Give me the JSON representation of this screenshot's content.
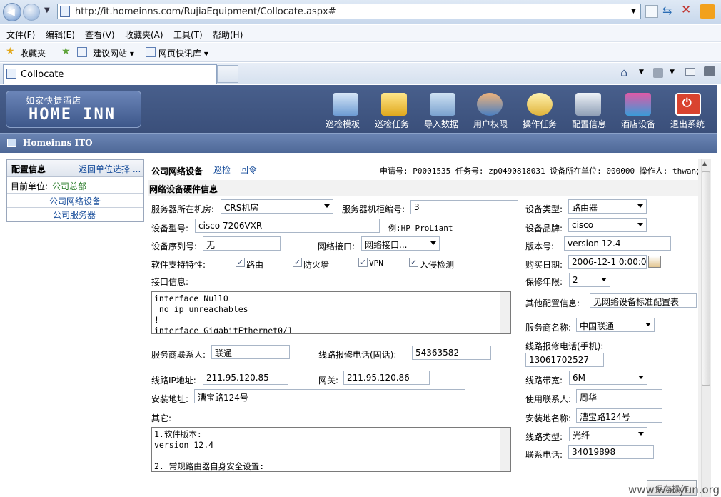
{
  "browser": {
    "url": "http://it.homeinns.com/RujiaEquipment/Collocate.aspx#",
    "menu": [
      "文件(F)",
      "编辑(E)",
      "查看(V)",
      "收藏夹(A)",
      "工具(T)",
      "帮助(H)"
    ],
    "favorites_label": "收藏夹",
    "fav_links": [
      "建议网站 ▾",
      "网页快讯库 ▾"
    ],
    "tab_title": "Collocate"
  },
  "header": {
    "logo_cn": "如家快捷酒店",
    "logo_en": "HOME INN",
    "nav": [
      "巡检模板",
      "巡检任务",
      "导入数据",
      "用户权限",
      "操作任务",
      "配置信息",
      "酒店设备",
      "退出系统"
    ],
    "subtitle": "Homeinns ITO"
  },
  "left": {
    "title": "配置信息",
    "back_link": "返回单位选择 ...",
    "current_unit_label": "目前单位:",
    "current_unit": "公司总部",
    "items": [
      "公司网络设备",
      "公司服务器"
    ]
  },
  "main": {
    "title": "公司网络设备",
    "link1": "巡检",
    "link2": "回令",
    "info": "申请号: P0001535  任务号: zp0490818031 设备所在单位: 000000 操作人: thwang",
    "section": "网络设备硬件信息",
    "fields": {
      "room_label": "服务器所在机房:",
      "room": "CRS机房",
      "cabinet_label": "服务器机柜编号:",
      "cabinet": "3",
      "devtype_label": "设备类型:",
      "devtype": "路由器",
      "model_label": "设备型号:",
      "model": "cisco 7206VXR",
      "model_hint": "例:HP ProLiant",
      "brand_label": "设备品牌:",
      "brand": "cisco",
      "serial_label": "设备序列号:",
      "serial": "无",
      "netif_label": "网络接口:",
      "netif": "网络接口...",
      "version_label": "版本号:",
      "version": "version 12.4",
      "software_label": "软件支持特性:",
      "features": [
        "路由",
        "防火墙",
        "VPN",
        "入侵检测"
      ],
      "buydate_label": "购买日期:",
      "buydate": "2006-12-1 0:00:00",
      "iface_label": "接口信息:",
      "iface_text": "interface Null0\n no ip unreachables\n!\ninterface GigabitEthernet0/1",
      "warranty_label": "保修年限:",
      "warranty": "2",
      "otherconf_label": "其他配置信息:",
      "otherconf": "见网络设备标准配置表",
      "isp_label": "服务商名称:",
      "isp": "中国联通",
      "isp_contact_label": "服务商联系人:",
      "isp_contact": "联通",
      "line_phone_label": "线路报修电话(固话):",
      "line_phone": "54363582",
      "mobile_label": "线路报修电话(手机):",
      "mobile": "13061702527",
      "ip_label": "线路IP地址:",
      "ip": "211.95.120.85",
      "gateway_label": "网关:",
      "gateway": "211.95.120.86",
      "bandwidth_label": "线路带宽:",
      "bandwidth": "6M",
      "address_label": "安装地址:",
      "address": "漕宝路124号",
      "user_contact_label": "使用联系人:",
      "user_contact": "周华",
      "site_name_label": "安装地名称:",
      "site_name": "漕宝路124号",
      "other_label": "其它:",
      "other_text": "1.软件版本:\nversion 12.4\n\n2. 常规路由器自身安全设置:",
      "linetype_label": "线路类型:",
      "linetype": "光纤",
      "phone_label": "联系电话:",
      "phone": "34019898",
      "save_button": "保存操作"
    }
  },
  "watermark": "www.wooyun.org"
}
